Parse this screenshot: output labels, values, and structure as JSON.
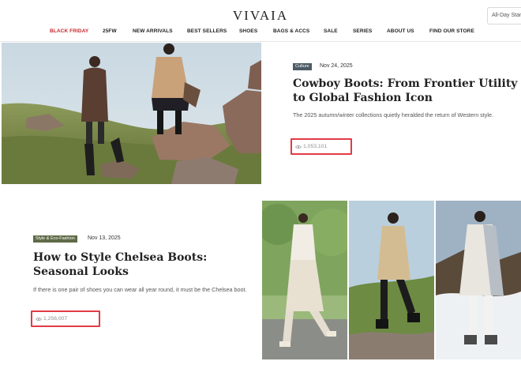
{
  "header": {
    "logo": "VIVAIA",
    "search_text": "All-Day Stan"
  },
  "nav": {
    "items": [
      {
        "label": "BLACK FRIDAY",
        "highlight": true
      },
      {
        "label": "25FW"
      },
      {
        "label": "NEW ARRIVALS"
      },
      {
        "label": "BEST SELLERS"
      },
      {
        "label": "SHOES"
      },
      {
        "label": "BAGS & ACCS"
      },
      {
        "label": "SALE"
      },
      {
        "label": "SERIES"
      },
      {
        "label": "ABOUT US"
      },
      {
        "label": "FIND OUR STORE"
      }
    ]
  },
  "articles": [
    {
      "tag": "Culture",
      "date": "Nov 24, 2025",
      "title": "Cowboy Boots: From Frontier Utility to Global Fashion Icon",
      "excerpt": "The 2025 autumn/winter collections quietly heralded the return of Western style.",
      "views": "1,053,101"
    },
    {
      "tag": "Style & Eco-Fashion",
      "date": "Nov 13, 2025",
      "title": "How to Style Chelsea Boots: Seasonal Looks",
      "excerpt": "If there is one pair of shoes you can wear all year round, it must be the Chelsea boot.",
      "views": "1,256,007"
    }
  ],
  "colors": {
    "highlight_red": "#c8272c",
    "views_border": "#e23b45",
    "tag_culture": "#4c5b65",
    "tag_style": "#5f6b47"
  },
  "icons": {
    "views": "eye-icon"
  }
}
